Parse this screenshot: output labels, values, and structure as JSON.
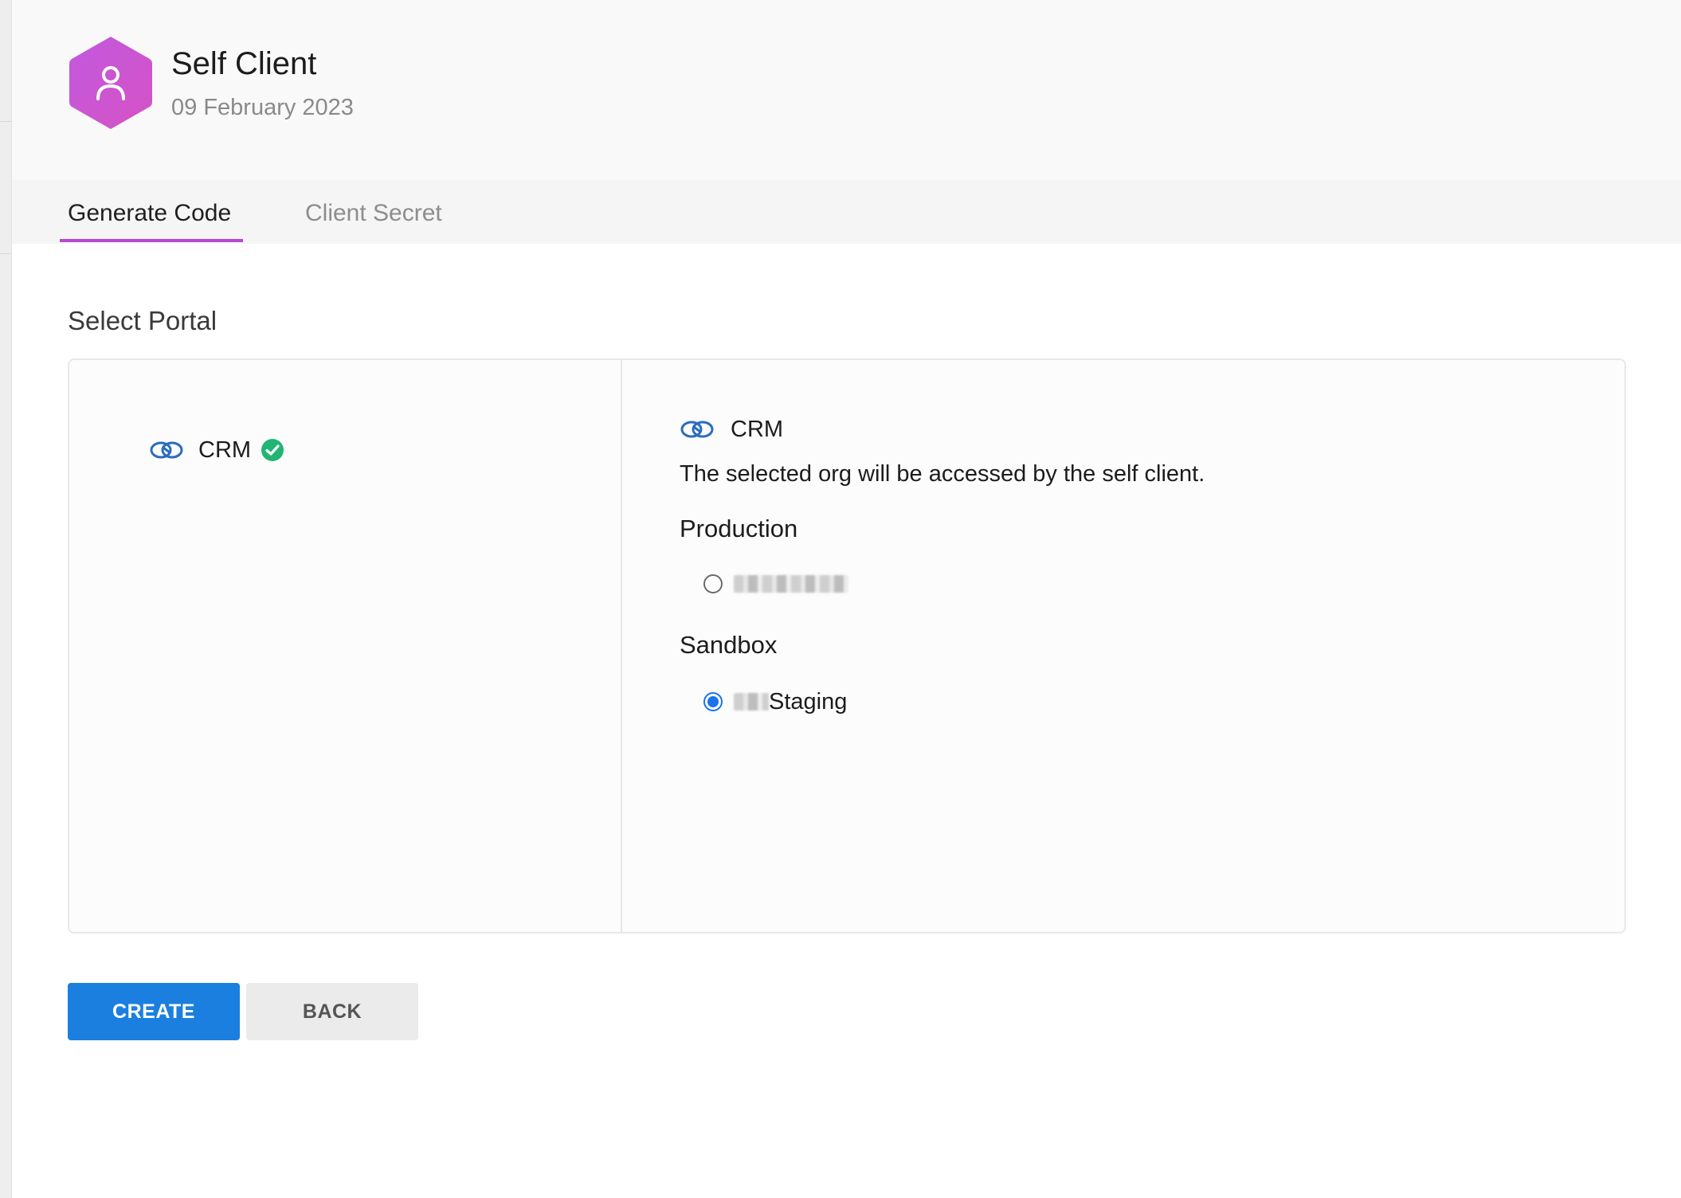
{
  "header": {
    "title": "Self Client",
    "date": "09 February 2023",
    "avatar_icon": "user-icon",
    "avatar_color": "#c84fd8"
  },
  "tabs": [
    {
      "label": "Generate Code",
      "active": true
    },
    {
      "label": "Client Secret",
      "active": false
    }
  ],
  "accent_color": "#b748d2",
  "section": {
    "title": "Select Portal"
  },
  "portals": [
    {
      "label": "CRM",
      "icon": "crm-link-icon",
      "status_icon": "check-circle-icon",
      "selected": true
    }
  ],
  "detail": {
    "portal_label": "CRM",
    "description": "The selected org will be accessed by the self client.",
    "groups": [
      {
        "label": "Production",
        "options": [
          {
            "label": "",
            "checked": false
          }
        ]
      },
      {
        "label": "Sandbox",
        "options": [
          {
            "label": "Staging",
            "checked": true
          }
        ]
      }
    ]
  },
  "actions": {
    "create_label": "CREATE",
    "back_label": "BACK",
    "primary_color": "#1b7fe0"
  }
}
